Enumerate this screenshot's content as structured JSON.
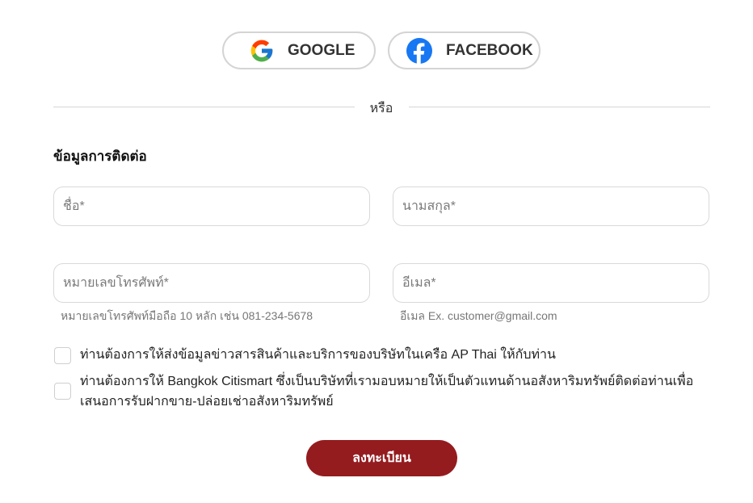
{
  "social": {
    "google_label": "GOOGLE",
    "facebook_label": "FACEBOOK"
  },
  "divider": {
    "text": "หรือ"
  },
  "contact": {
    "title": "ข้อมูลการติดต่อ",
    "first_name_placeholder": "ชื่อ*",
    "last_name_placeholder": "นามสกุล*",
    "phone_placeholder": "หมายเลขโทรศัพท์*",
    "email_placeholder": "อีเมล*",
    "phone_hint": "หมายเลขโทรศัพท์มือถือ 10 หลัก เช่น 081-234-5678",
    "email_hint": "อีเมล Ex. customer@gmail.com"
  },
  "consents": [
    {
      "label": "ท่านต้องการให้ส่งข้อมูลข่าวสารสินค้าและบริการของบริษัทในเครือ AP Thai ให้กับท่าน",
      "checked": false
    },
    {
      "label": "ท่านต้องการให้ Bangkok Citismart ซึ่งเป็นบริษัทที่เรามอบหมายให้เป็นตัวแทนด้านอสังหาริมทรัพย์ติดต่อท่านเพื่อเสนอการรับฝากขาย-ปล่อยเช่าอสังหาริมทรัพย์",
      "checked": false
    }
  ],
  "submit_label": "ลงทะเบียน",
  "colors": {
    "primary": "#941c1f",
    "facebook_blue": "#1877f2",
    "border": "#d9d9d9"
  },
  "icons": {
    "google": "google-icon",
    "facebook": "facebook-icon"
  }
}
